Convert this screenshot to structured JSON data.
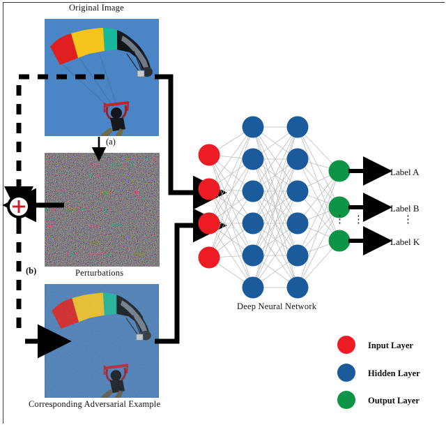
{
  "figure": {
    "captions": {
      "original_image": "Original Image",
      "perturbations": "Perturbations",
      "adversarial": "Corresponding Adversarial Example",
      "network": "Deep Neural Network"
    },
    "step_tags": {
      "a": "(a)",
      "b": "(b)"
    },
    "operator_symbol": "+"
  },
  "outputs": {
    "labels": [
      {
        "text": "Label  A"
      },
      {
        "text": "Label  K"
      }
    ],
    "middle_label": "Label  B",
    "ellipsis": "⋮"
  },
  "legend": {
    "items": [
      {
        "label": "Input Layer",
        "color": "#ED1C24"
      },
      {
        "label": "Hidden Layer",
        "color": "#1B5A9B"
      },
      {
        "label": "Output Layer",
        "color": "#0E9447"
      }
    ]
  },
  "network": {
    "layers": [
      {
        "name": "input",
        "color": "#ED1C24",
        "count": 4
      },
      {
        "name": "hidden-1",
        "color": "#1B5A9B",
        "count": 6
      },
      {
        "name": "hidden-2",
        "color": "#1B5A9B",
        "count": 6
      },
      {
        "name": "output",
        "color": "#0E9447",
        "count": 3
      }
    ],
    "edge_color": "#b9b9b9"
  },
  "colors": {
    "arrow": "#000000",
    "plus": "#cc1f2b",
    "frame": "#3a3a3a",
    "sky": "#4a86c5",
    "sky_adv": "#4d7fb4"
  }
}
